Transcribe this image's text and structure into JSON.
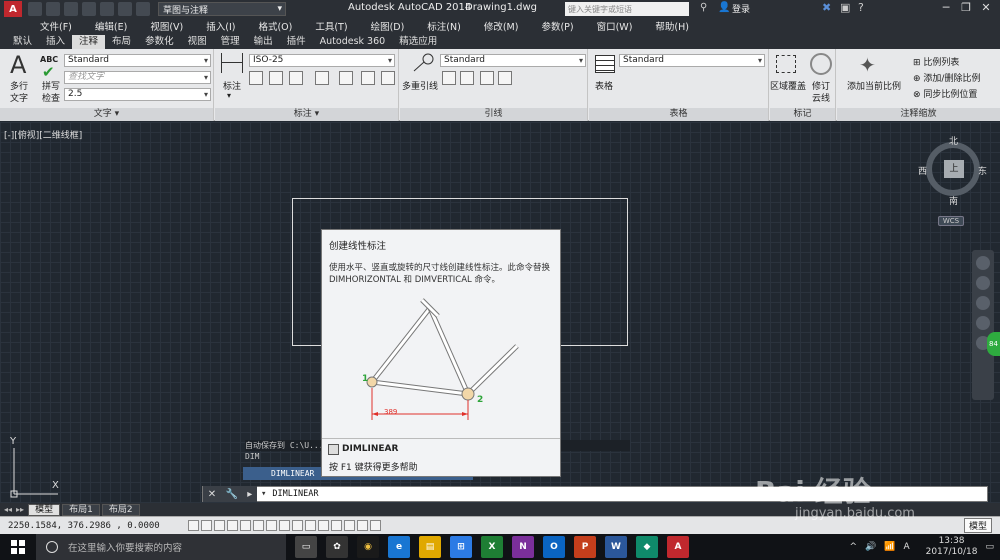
{
  "titlebar": {
    "logo": "A",
    "workspace": "草图与注释",
    "app_name": "Autodesk AutoCAD 2014",
    "doc_name": "Drawing1.dwg",
    "search_placeholder": "键入关键字或短语",
    "login": "登录"
  },
  "menubar": [
    "文件(F)",
    "编辑(E)",
    "视图(V)",
    "插入(I)",
    "格式(O)",
    "工具(T)",
    "绘图(D)",
    "标注(N)",
    "修改(M)",
    "参数(P)",
    "窗口(W)",
    "帮助(H)"
  ],
  "ribbon_tabs": [
    {
      "label": "默认",
      "active": false
    },
    {
      "label": "插入",
      "active": false
    },
    {
      "label": "注释",
      "active": true
    },
    {
      "label": "布局",
      "active": false
    },
    {
      "label": "参数化",
      "active": false
    },
    {
      "label": "视图",
      "active": false
    },
    {
      "label": "管理",
      "active": false
    },
    {
      "label": "输出",
      "active": false
    },
    {
      "label": "插件",
      "active": false
    },
    {
      "label": "Autodesk 360",
      "active": false
    },
    {
      "label": "精选应用",
      "active": false
    }
  ],
  "ribbon": {
    "text_panel": {
      "title": "文字",
      "multiline_label": "多行",
      "multiline_label2": "文字",
      "spell_label": "拼写",
      "spell_label2": "检查",
      "abc": "ABC",
      "style": "Standard",
      "find_placeholder": "查找文字",
      "height": "2.5"
    },
    "dim_panel": {
      "title": "标注",
      "dim_label": "标注",
      "style": "ISO-25"
    },
    "leader_panel": {
      "title": "引线",
      "multileader_label": "多重引线",
      "style": "Standard"
    },
    "table_panel": {
      "title": "表格",
      "table_label": "表格",
      "style": "Standard"
    },
    "markup_panel": {
      "title": "标记",
      "wipeout_label": "区域覆盖",
      "revcloud_label": "修订",
      "revcloud_label2": "云线"
    },
    "scale_panel": {
      "title": "注释缩放",
      "add_current_label": "添加当前比例",
      "scale_list": "比例列表",
      "add_delete": "添加/删除比例",
      "sync": "同步比例位置"
    }
  },
  "viewport": {
    "view_label": "[-][俯视][二维线框]",
    "compass": {
      "n": "北",
      "s": "南",
      "e": "东",
      "w": "西",
      "top": "上"
    },
    "wcs": "WCS",
    "ucs_x": "X",
    "ucs_y": "Y",
    "badge": "84"
  },
  "tooltip": {
    "title": "创建线性标注",
    "description": "使用水平、竖直或旋转的尺寸线创建线性标注。此命令替换 DIMHORIZONTAL 和 DIMVERTICAL 命令。",
    "dim_value": "389",
    "point1": "1",
    "point2": "2",
    "command": "DIMLINEAR",
    "help": "按 F1 键获得更多帮助"
  },
  "command_history": {
    "line1": "自动保存到 C:\\U...                                    .sv$ ...DIM",
    "line2": "DIM",
    "autocomplete": "DIMLINEAR"
  },
  "cmdline": {
    "input": "DIMLINEAR"
  },
  "layout_tabs": [
    {
      "label": "模型",
      "active": true
    },
    {
      "label": "布局1",
      "active": false
    },
    {
      "label": "布局2",
      "active": false
    }
  ],
  "statusbar": {
    "coords": "2250.1584, 376.2986 , 0.0000",
    "model": "模型"
  },
  "taskbar": {
    "search_placeholder": "在这里输入你要搜索的内容",
    "time": "13:38",
    "date": "2017/10/18"
  },
  "watermark": {
    "text": "Bai 经验",
    "sub": "jingyan.baidu.com"
  },
  "colors": {
    "accent_red": "#c0282e",
    "dim_red": "#e0302a",
    "point_green": "#2ea43a"
  }
}
